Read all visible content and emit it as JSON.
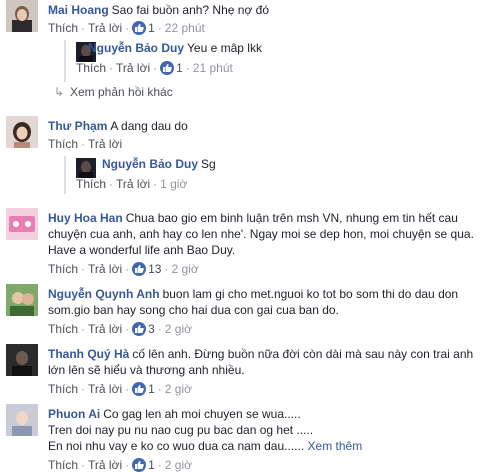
{
  "ui": {
    "like_label": "Thích",
    "reply_label": "Trả lời",
    "see_more_label": "Xem thêm"
  },
  "comments": [
    {
      "author": "Mai Hoang",
      "text": "Sao fai buồn anh? Nhẹ nợ đó",
      "likes": "1",
      "time": "22 phút"
    },
    {
      "author": "Nguyễn Bảo Duy",
      "text": "Yeu e mâp lkk",
      "likes": "1",
      "time": "21 phút"
    },
    {
      "more_replies": "Xem phản hồi khác"
    },
    {
      "author": "Thư Phạm",
      "text": "A dang dau do",
      "likes": "",
      "time": ""
    },
    {
      "author": "Nguyễn Bảo Duy",
      "text": "Sg",
      "likes": "",
      "time": "1 giờ"
    },
    {
      "author": "Huy Hoa Han",
      "text_lines": [
        "Chua bao gio em binh luận trên msh VN, nhung em tin hết cau",
        "chuyện cua anh, anh hay co len nhe'. Ngay moi se dep hon, moi chuyện se qua.",
        "Have a wonderful life anh Bao Duy."
      ],
      "likes": "13",
      "time": "2 giờ"
    },
    {
      "author": "Nguyễn Quynh Anh",
      "text_lines": [
        "buon lam gi cho met.nguoi ko tot bo som thi do dau don",
        "som.gio ban hay song cho hai dua con gai cua ban do."
      ],
      "likes": "3",
      "time": "2 giờ"
    },
    {
      "author": "Thanh Quý Hà",
      "text_lines": [
        "cố lên anh. Đừng buồn nữa đời còn dài mà sau này con trai anh",
        "lớn lên sẽ hiểu và thương anh nhiều."
      ],
      "likes": "1",
      "time": "2 giờ"
    },
    {
      "author": "Phuon Ai",
      "text_lines": [
        "Co gag len ah moi chuyen se wua.....",
        "Tren doi nay pu nu nao cug pu bac dan og het .....",
        "En noi nhu vay e ko co wuo dua ca nam dau......"
      ],
      "likes": "1",
      "time": "2 giờ"
    }
  ],
  "colors": {
    "author": "#365899",
    "like_badge": "#4267b2",
    "meta": "#90949c",
    "thread_line": "#dddfe2"
  }
}
